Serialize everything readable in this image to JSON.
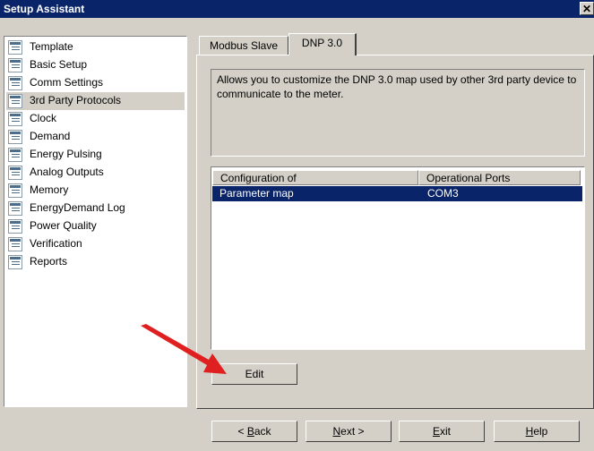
{
  "window": {
    "title": "Setup Assistant",
    "close_glyph": "✕"
  },
  "sidebar": {
    "selected_index": 3,
    "items": [
      {
        "label": "Template",
        "icon": "settings-page-icon"
      },
      {
        "label": "Basic Setup",
        "icon": "settings-page-icon"
      },
      {
        "label": "Comm Settings",
        "icon": "settings-page-icon"
      },
      {
        "label": "3rd Party Protocols",
        "icon": "settings-page-icon"
      },
      {
        "label": "Clock",
        "icon": "settings-page-icon"
      },
      {
        "label": "Demand",
        "icon": "settings-page-icon"
      },
      {
        "label": "Energy Pulsing",
        "icon": "settings-page-icon"
      },
      {
        "label": "Analog Outputs",
        "icon": "settings-page-icon"
      },
      {
        "label": "Memory",
        "icon": "settings-page-icon"
      },
      {
        "label": "EnergyDemand Log",
        "icon": "settings-page-icon"
      },
      {
        "label": "Power Quality",
        "icon": "settings-page-icon"
      },
      {
        "label": "Verification",
        "icon": "settings-page-icon"
      },
      {
        "label": "Reports",
        "icon": "settings-page-icon"
      }
    ]
  },
  "tabs": {
    "items": [
      {
        "label": "Modbus Slave"
      },
      {
        "label": "DNP 3.0"
      }
    ],
    "active": "DNP 3.0"
  },
  "panel": {
    "description": "Allows you to customize the DNP 3.0 map used by other 3rd party device to communicate to the meter.",
    "table": {
      "headers": [
        "Configuration of",
        "Operational Ports"
      ],
      "rows": [
        {
          "configuration": "Parameter map",
          "ports": "COM3",
          "selected": true
        }
      ]
    },
    "edit_label": "Edit"
  },
  "footer": {
    "back_label": "< Back",
    "back_mnemonic": "B",
    "next_label": "Next >",
    "next_mnemonic": "N",
    "exit_label": "Exit",
    "exit_mnemonic": "E",
    "help_label": "Help",
    "help_mnemonic": "H"
  },
  "colors": {
    "titlebar": "#0a246a",
    "selection": "#0a246a",
    "face": "#d4d0c8",
    "arrow": "#e02020"
  }
}
